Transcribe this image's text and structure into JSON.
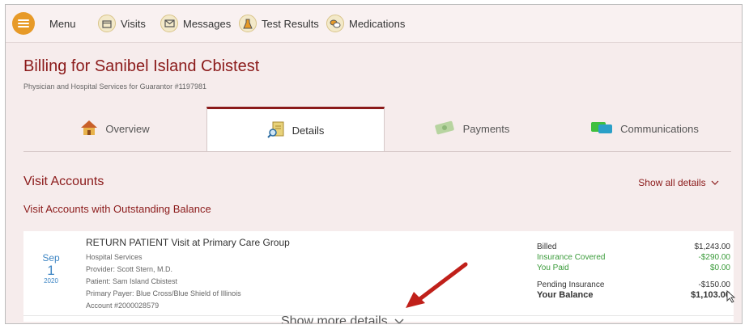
{
  "topbar": {
    "menu_label": "Menu",
    "nav": [
      {
        "label": "Visits",
        "icon": "calendar-icon"
      },
      {
        "label": "Messages",
        "icon": "envelope-icon"
      },
      {
        "label": "Test Results",
        "icon": "flask-icon"
      },
      {
        "label": "Medications",
        "icon": "pills-icon"
      }
    ]
  },
  "header": {
    "title": "Billing for Sanibel Island Cbistest",
    "subtitle": "Physician and Hospital Services for Guarantor #1197981"
  },
  "tabs": [
    {
      "label": "Overview",
      "icon": "house-icon",
      "active": false
    },
    {
      "label": "Details",
      "icon": "magnifier-document-icon",
      "active": true
    },
    {
      "label": "Payments",
      "icon": "money-icon",
      "active": false
    },
    {
      "label": "Communications",
      "icon": "chat-bubbles-icon",
      "active": false
    }
  ],
  "section": {
    "title": "Visit Accounts",
    "show_all": "Show all details",
    "subsection": "Visit Accounts with Outstanding Balance"
  },
  "visit": {
    "date_month": "Sep",
    "date_day": "1",
    "date_year": "2020",
    "title": "RETURN PATIENT Visit at Primary Care Group",
    "service": "Hospital Services",
    "provider": "Provider: Scott Stern, M.D.",
    "patient": "Patient: Sam Island Cbistest",
    "payer": "Primary Payer: Blue Cross/Blue Shield of Illinois",
    "account": "Account #2000028579",
    "billed_label": "Billed",
    "billed_value": "$1,243.00",
    "insurance_label": "Insurance Covered",
    "insurance_value": "-$290.00",
    "paid_label": "You Paid",
    "paid_value": "$0.00",
    "pending_label": "Pending Insurance",
    "pending_value": "-$150.00",
    "balance_label": "Your Balance",
    "balance_value": "$1,103.00"
  },
  "show_more": "Show more details",
  "colors": {
    "accent": "#8b1a1a",
    "menu_orange": "#e79a28",
    "date_blue": "#3e86c4",
    "green": "#3a9b3a",
    "arrow_red": "#c0201a"
  }
}
